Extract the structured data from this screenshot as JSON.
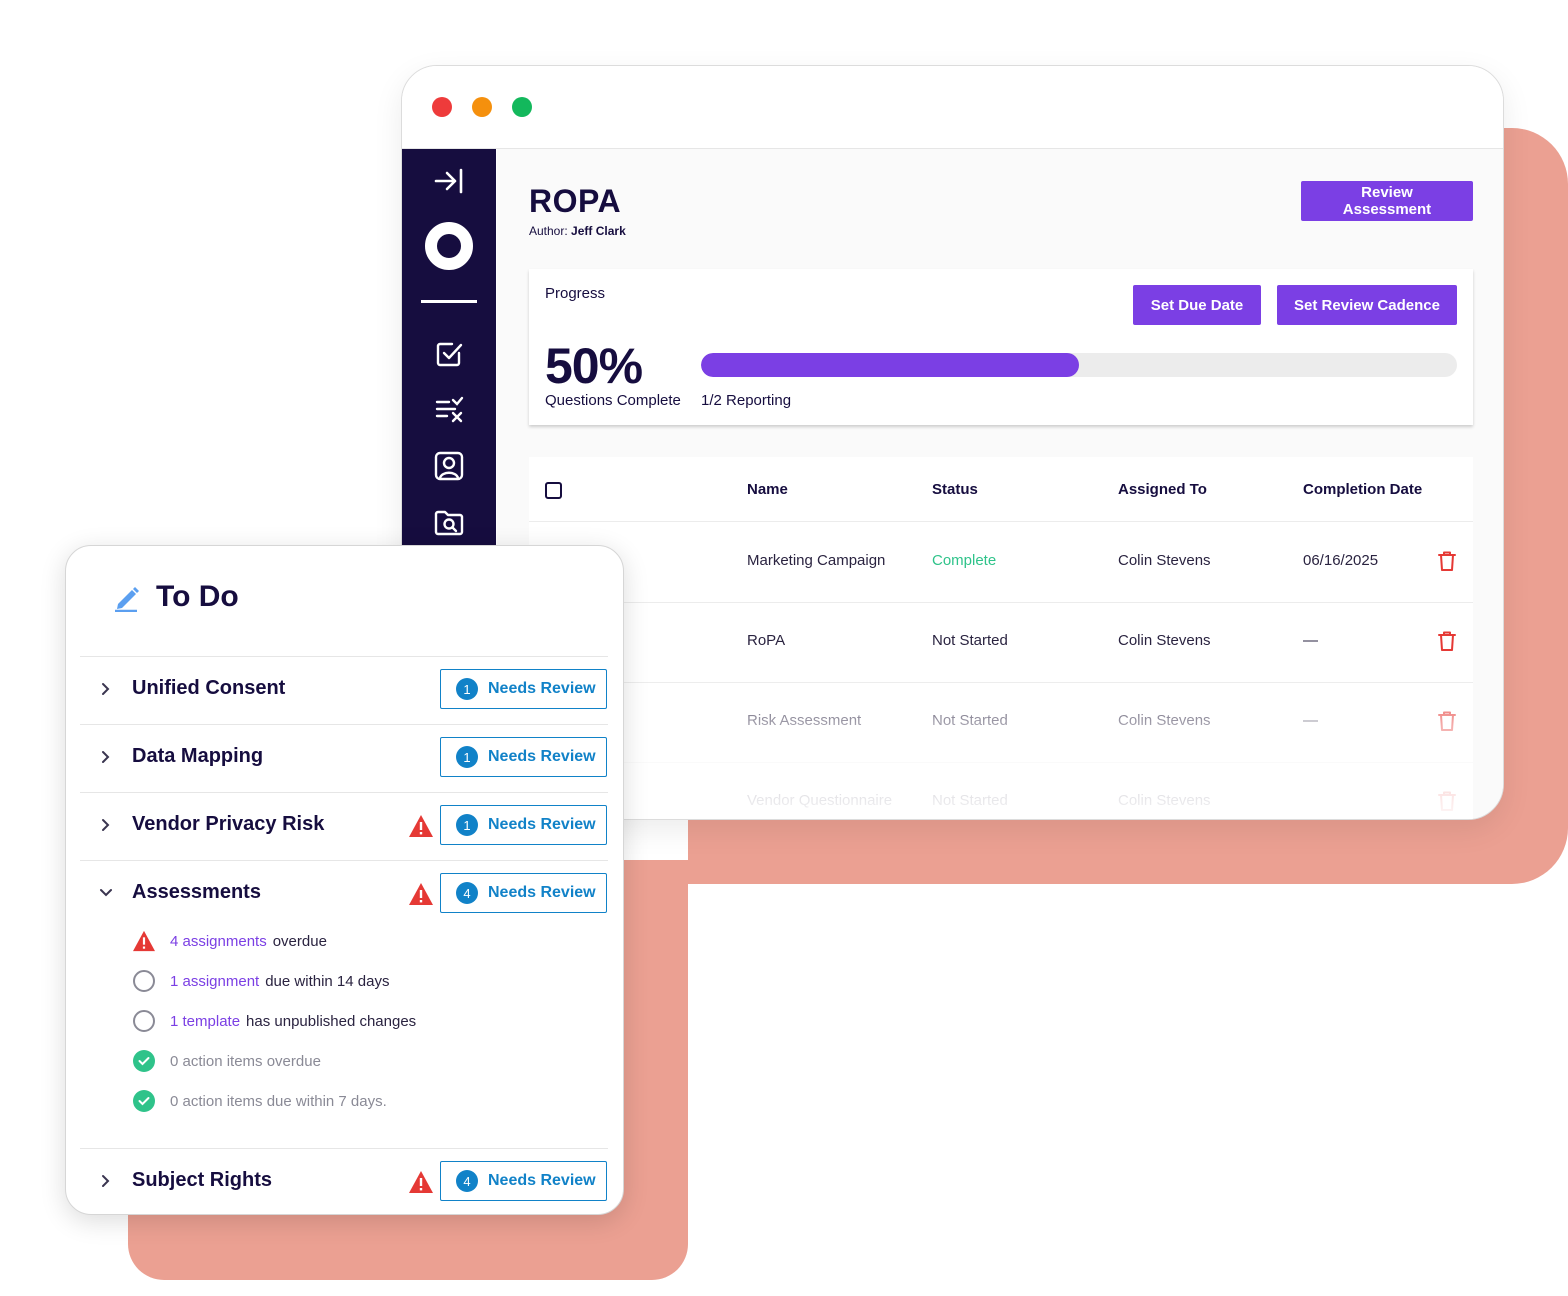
{
  "window": {
    "title": "ROPA",
    "author_label": "Author:",
    "author_name": "Jeff Clark",
    "review_button": "Review Assessment"
  },
  "sidebar": {
    "items": [
      {
        "icon": "collapse-sidebar-icon"
      },
      {
        "icon": "logo-ring-icon"
      },
      {
        "icon": "task-check-icon"
      },
      {
        "icon": "list-check-icon"
      },
      {
        "icon": "contact-card-icon"
      },
      {
        "icon": "folder-search-icon"
      }
    ]
  },
  "progress": {
    "label": "Progress",
    "set_due_date": "Set Due Date",
    "set_review_cadence": "Set Review Cadence",
    "percent_text": "50%",
    "percent_value": 0.5,
    "questions_complete": "Questions Complete",
    "reporting": "1/2 Reporting"
  },
  "table": {
    "headers": {
      "name": "Name",
      "status": "Status",
      "assigned_to": "Assigned To",
      "completion_date": "Completion Date"
    },
    "rows": [
      {
        "name": "Marketing Campaign",
        "status": "Complete",
        "assigned_to": "Colin Stevens",
        "completion_date": "06/16/2025"
      },
      {
        "name": "RoPA",
        "status": "Not Started",
        "assigned_to": "Colin Stevens",
        "completion_date": "—"
      },
      {
        "name": "Risk Assessment",
        "status": "Not Started",
        "assigned_to": "Colin Stevens",
        "completion_date": "—"
      },
      {
        "name": "Vendor Questionnaire",
        "status": "Not Started",
        "assigned_to": "Colin Stevens",
        "completion_date": ""
      }
    ]
  },
  "todo": {
    "title": "To Do",
    "needs_review": "Needs Review",
    "rows": [
      {
        "label": "Unified Consent",
        "count": "1",
        "warning": false
      },
      {
        "label": "Data Mapping",
        "count": "1",
        "warning": false
      },
      {
        "label": "Vendor Privacy Risk",
        "count": "1",
        "warning": true
      },
      {
        "label": "Assessments",
        "count": "4",
        "warning": true
      },
      {
        "label": "Subject Rights",
        "count": "4",
        "warning": true
      }
    ],
    "assessment_items": [
      {
        "link": "4 assignments",
        "text": "overdue"
      },
      {
        "link": "1 assignment",
        "text": "due within 14 days"
      },
      {
        "link": "1 template",
        "text": "has unpublished changes"
      },
      {
        "text": "0 action items overdue"
      },
      {
        "text": "0 action items due within 7 days."
      }
    ]
  },
  "colors": {
    "accent_purple": "#7b3fe4",
    "sidebar_navy": "#160d3f",
    "needs_review_blue": "#1182c8",
    "complete_green": "#2fc38a",
    "warning_red": "#e53935",
    "backdrop_salmon": "#eba092"
  }
}
